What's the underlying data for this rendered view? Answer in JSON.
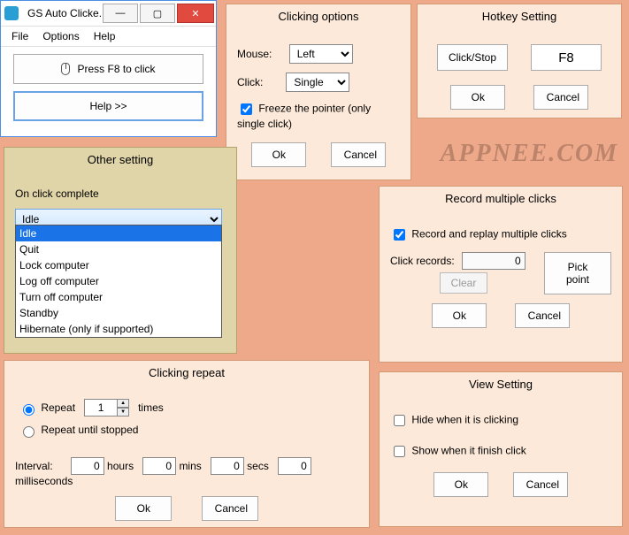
{
  "main_window": {
    "title": "GS Auto Clicke...",
    "menu": {
      "file": "File",
      "options": "Options",
      "help": "Help"
    },
    "press_button": "Press F8 to click",
    "help_button": "Help >>"
  },
  "clicking_options": {
    "title": "Clicking options",
    "mouse_label": "Mouse:",
    "mouse_value": "Left",
    "click_label": "Click:",
    "click_value": "Single",
    "freeze_checked": true,
    "freeze_label": "Freeze the pointer (only single click)",
    "ok": "Ok",
    "cancel": "Cancel"
  },
  "hotkey": {
    "title": "Hotkey Setting",
    "click_stop": "Click/Stop",
    "hotkey_value": "F8",
    "ok": "Ok",
    "cancel": "Cancel"
  },
  "other_setting": {
    "title": "Other setting",
    "on_click_complete": "On click complete",
    "selected_value": "Idle",
    "options": [
      "Idle",
      "Quit",
      "Lock computer",
      "Log off computer",
      "Turn off computer",
      "Standby",
      "Hibernate (only if supported)"
    ]
  },
  "watermark": "APPNEE.COM",
  "clicking_repeat": {
    "title": "Clicking repeat",
    "repeat_label": "Repeat",
    "repeat_times_value": "1",
    "times_label": "times",
    "repeat_until_label": "Repeat until stopped",
    "interval_label": "Interval:",
    "hours_value": "0",
    "hours_label": "hours",
    "mins_value": "0",
    "mins_label": "mins",
    "secs_value": "0",
    "secs_label": "secs",
    "ms_value": "0",
    "ms_label": "milliseconds",
    "ok": "Ok",
    "cancel": "Cancel"
  },
  "record": {
    "title": "Record multiple clicks",
    "record_replay_checked": true,
    "record_replay_label": "Record and replay multiple clicks",
    "click_records_label": "Click records:",
    "click_records_value": "0",
    "clear": "Clear",
    "pick_point": "Pick point",
    "ok": "Ok",
    "cancel": "Cancel"
  },
  "view_setting": {
    "title": "View Setting",
    "hide_checked": false,
    "hide_label": "Hide when it is clicking",
    "show_checked": false,
    "show_label": "Show when it finish click",
    "ok": "Ok",
    "cancel": "Cancel"
  }
}
